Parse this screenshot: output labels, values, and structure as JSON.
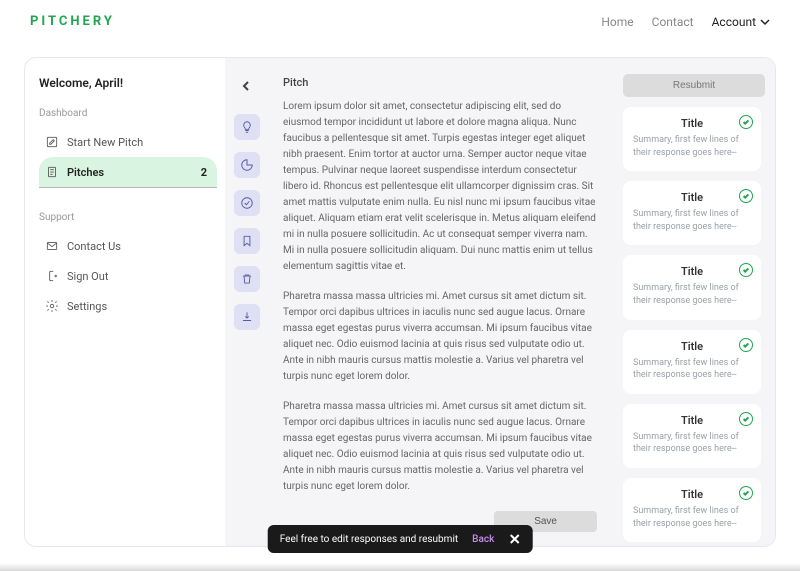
{
  "brand": "PITCHERY",
  "nav": {
    "home": "Home",
    "contact": "Contact",
    "account": "Account"
  },
  "sidebar": {
    "welcome": "Welcome, April!",
    "dashboard_label": "Dashboard",
    "start_new": "Start New Pitch",
    "pitches": "Pitches",
    "pitches_count": "2",
    "support_label": "Support",
    "contact_us": "Contact Us",
    "sign_out": "Sign Out",
    "settings": "Settings"
  },
  "content": {
    "title": "Pitch",
    "p1": "Lorem ipsum dolor sit amet, consectetur adipiscing elit, sed do eiusmod tempor incididunt ut labore et dolore magna aliqua. Nunc faucibus a pellentesque sit amet. Turpis egestas integer eget aliquet nibh praesent. Enim tortor at auctor urna. Semper auctor neque vitae tempus. Pulvinar neque laoreet suspendisse interdum consectetur libero id. Rhoncus est pellentesque elit ullamcorper dignissim cras. Sit amet mattis vulputate enim nulla. Eu nisl nunc mi ipsum faucibus vitae aliquet. Aliquam etiam erat velit scelerisque in. Metus aliquam eleifend mi in nulla posuere sollicitudin. Ac ut consequat semper viverra nam. Mi in nulla posuere sollicitudin aliquam. Dui nunc mattis enim ut tellus elementum sagittis vitae et.",
    "p2": "Pharetra massa massa ultricies mi. Amet cursus sit amet dictum sit. Tempor orci dapibus ultrices in iaculis nunc sed augue lacus. Ornare massa eget egestas purus viverra accumsan. Mi ipsum faucibus vitae aliquet nec. Odio euismod lacinia at quis risus sed vulputate odio ut. Ante in nibh mauris cursus mattis molestie a. Varius vel pharetra vel turpis nunc eget lorem dolor.",
    "p3": "Pharetra massa massa ultricies mi. Amet cursus sit amet dictum sit. Tempor orci dapibus ultrices in iaculis nunc sed augue lacus. Ornare massa eget egestas purus viverra accumsan. Mi ipsum faucibus vitae aliquet nec. Odio euismod lacinia at quis risus sed vulputate odio ut. Ante in nibh mauris cursus mattis molestie a. Varius vel pharetra vel turpis nunc eget lorem dolor.",
    "save": "Save"
  },
  "right": {
    "resubmit": "Resubmit",
    "cards": [
      {
        "title": "Title",
        "sub": "Summary, first few lines of their response goes here--"
      },
      {
        "title": "Title",
        "sub": "Summary, first few lines of their response goes here--"
      },
      {
        "title": "Title",
        "sub": "Summary, first few lines of their response goes here--"
      },
      {
        "title": "Title",
        "sub": "Summary, first few lines of their response goes here--"
      },
      {
        "title": "Title",
        "sub": "Summary, first few lines of their response goes here--"
      },
      {
        "title": "Title",
        "sub": "Summary, first few lines of their response goes here--"
      }
    ]
  },
  "toast": {
    "msg": "Feel free to edit responses and resubmit",
    "back": "Back"
  }
}
